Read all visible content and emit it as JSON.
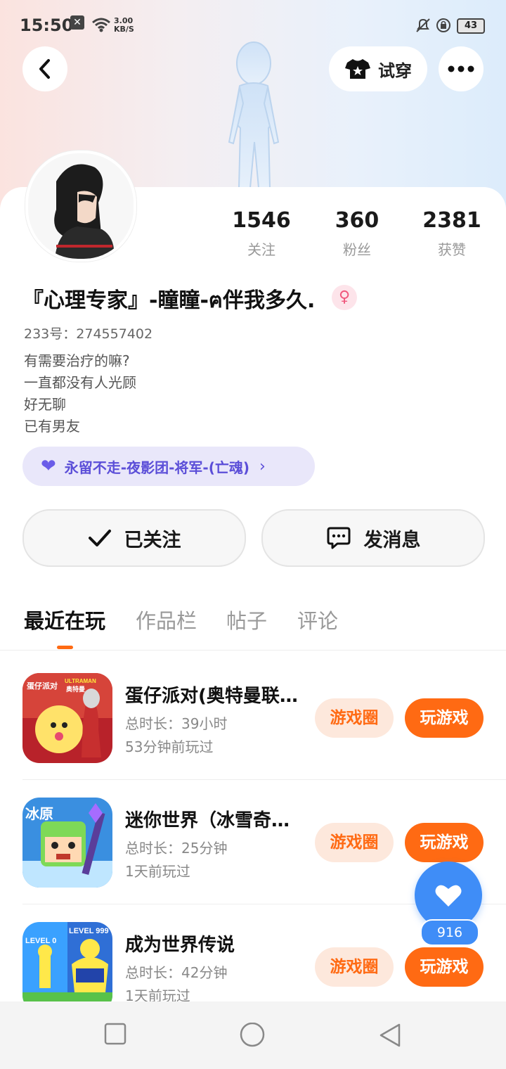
{
  "status_bar": {
    "time": "15:50",
    "network_speed_value": "3.00",
    "network_speed_unit": "KB/S",
    "battery": "43"
  },
  "header": {
    "tryon_label": "试穿"
  },
  "profile": {
    "stats": [
      {
        "value": "1546",
        "label": "关注"
      },
      {
        "value": "360",
        "label": "粉丝"
      },
      {
        "value": "2381",
        "label": "获赞"
      }
    ],
    "nickname": "『心理专家』-瞳瞳-ฅ伴我多久.",
    "gender_symbol": "♀",
    "uid": "233号：274557402",
    "bio_lines": [
      "有需要治疗的嘛?",
      "一直都没有人光顾",
      "好无聊",
      "已有男友"
    ],
    "group_label": "永留不走-夜影团-将军-(亡魂)",
    "follow_label": "已关注",
    "message_label": "发消息"
  },
  "tabs": [
    "最近在玩",
    "作品栏",
    "帖子",
    "评论"
  ],
  "games": [
    {
      "title": "蛋仔派对(奥特曼联动)",
      "duration": "总时长：39小时",
      "last_played": "53分钟前玩过",
      "circle_label": "游戏圈",
      "play_label": "玩游戏"
    },
    {
      "title": "迷你世界（冰雪奇缘）",
      "duration": "总时长：25分钟",
      "last_played": "1天前玩过",
      "circle_label": "游戏圈",
      "play_label": "玩游戏"
    },
    {
      "title": "成为世界传说",
      "duration": "总时长：42分钟",
      "last_played": "1天前玩过",
      "circle_label": "游戏圈",
      "play_label": "玩游戏"
    }
  ],
  "game_icon_text": {
    "g1_brand_cn": "蛋仔派对",
    "g1_brand_en": "ULTRAMAN",
    "g1_brand_cn2": "奥特曼",
    "g2_badge": "冰原",
    "g3_level_left": "LEVEL 0",
    "g3_level_right": "LEVEL 999"
  },
  "floating_like": {
    "count": "916"
  },
  "colors": {
    "accent_orange": "#ff6a13",
    "like_blue": "#3f8df7",
    "group_purple": "#5b4ed8"
  }
}
